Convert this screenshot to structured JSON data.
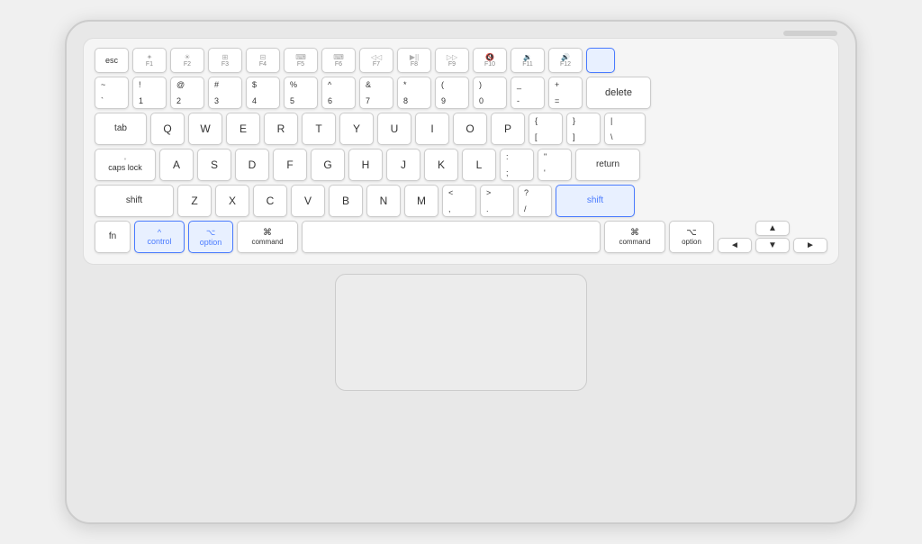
{
  "keyboard": {
    "rows": {
      "fn_row": [
        "esc",
        "F1",
        "F2",
        "F3",
        "F4",
        "F5",
        "F6",
        "F7",
        "F8",
        "F9",
        "F10",
        "F11",
        "F12"
      ],
      "number_row": [
        "~`",
        "!1",
        "@2",
        "#3",
        "$4",
        "%5",
        "^6",
        "&7",
        "*8",
        "(9",
        ")0",
        "-_",
        "+=",
        "delete"
      ],
      "qwerty": [
        "tab",
        "Q",
        "W",
        "E",
        "R",
        "T",
        "Y",
        "U",
        "I",
        "O",
        "P",
        "[{",
        "}]",
        "|\\"
      ],
      "home": [
        "caps lock",
        "A",
        "S",
        "D",
        "F",
        "G",
        "H",
        "J",
        "K",
        "L",
        ";:",
        "'\"",
        "return"
      ],
      "shift": [
        "shift",
        "Z",
        "X",
        "C",
        "V",
        "B",
        "N",
        "M",
        "<,",
        ">.",
        "?/",
        "shift"
      ],
      "bottom": [
        "fn",
        "control",
        "option",
        "command",
        "space",
        "command",
        "option",
        "◄",
        "▼▲",
        "►"
      ]
    },
    "highlighted_keys": [
      "control",
      "option_left",
      "power",
      "shift_right"
    ],
    "colors": {
      "highlight": "#4a7bff",
      "highlight_bg": "#e8f0ff",
      "normal_bg": "#ffffff",
      "border": "#cccccc"
    }
  }
}
